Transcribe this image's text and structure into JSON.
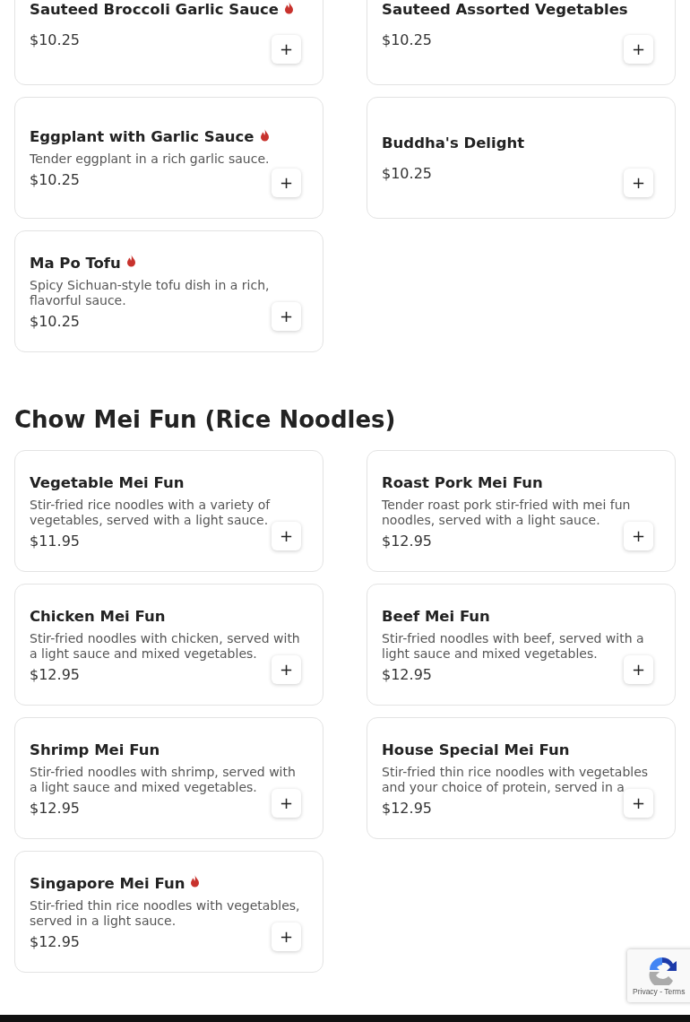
{
  "sections": [
    {
      "items": [
        {
          "name": "Sauteed Broccoli Garlic Sauce",
          "spicy": true,
          "price": "$10.25",
          "add": "+"
        },
        {
          "name": "Sauteed Assorted Vegetables",
          "spicy": false,
          "price": "$10.25",
          "add": "+"
        },
        {
          "name": "Eggplant with Garlic Sauce",
          "spicy": true,
          "description": "Tender eggplant in a rich garlic sauce.",
          "price": "$10.25",
          "add": "+"
        },
        {
          "name": "Buddha's Delight",
          "spicy": false,
          "price": "$10.25",
          "add": "+"
        },
        {
          "name": "Ma Po Tofu",
          "spicy": true,
          "description": "Spicy Sichuan-style tofu dish in a rich, flavorful sauce.",
          "price": "$10.25",
          "add": "+"
        }
      ]
    },
    {
      "title": "Chow Mei Fun (Rice Noodles)",
      "items": [
        {
          "name": "Vegetable Mei Fun",
          "spicy": false,
          "description": "Stir-fried rice noodles with a variety of vegetables, served with a light sauce.",
          "price": "$11.95",
          "add": "+"
        },
        {
          "name": "Roast Pork Mei Fun",
          "spicy": false,
          "description": "Tender roast pork stir-fried with mei fun noodles, served with a light sauce.",
          "price": "$12.95",
          "add": "+"
        },
        {
          "name": "Chicken Mei Fun",
          "spicy": false,
          "description": "Stir-fried noodles with chicken, served with a light sauce and mixed vegetables.",
          "price": "$12.95",
          "add": "+"
        },
        {
          "name": "Beef Mei Fun",
          "spicy": false,
          "description": "Stir-fried noodles with beef, served with a light sauce and mixed vegetables.",
          "price": "$12.95",
          "add": "+"
        },
        {
          "name": "Shrimp Mei Fun",
          "spicy": false,
          "description": "Stir-fried noodles with shrimp, served with a light sauce and mixed vegetables.",
          "price": "$12.95",
          "add": "+"
        },
        {
          "name": "House Special Mei Fun",
          "spicy": false,
          "description": "Stir-fried thin rice noodles with vegetables and your choice of protein, served in a",
          "price": "$12.95",
          "add": "+"
        },
        {
          "name": "Singapore Mei Fun",
          "spicy": true,
          "description": "Stir-fried thin rice noodles with vegetables, served in a light sauce.",
          "price": "$12.95",
          "add": "+"
        }
      ]
    }
  ],
  "recaptcha": {
    "links": "Privacy - Terms"
  }
}
